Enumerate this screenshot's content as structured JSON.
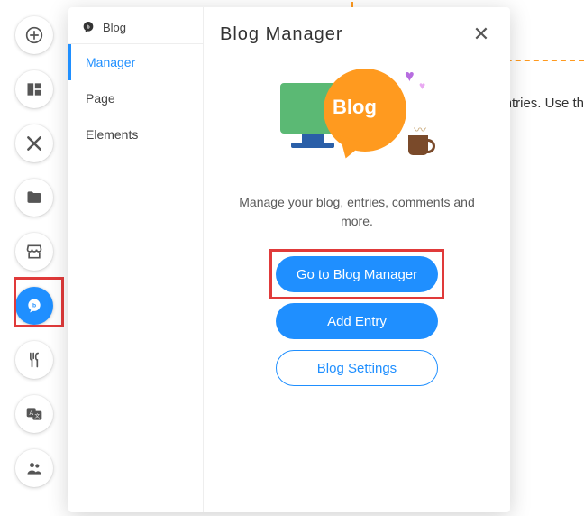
{
  "panel": {
    "blog_label": "Blog",
    "nav": {
      "manager": "Manager",
      "page": "Page",
      "elements": "Elements"
    },
    "title": "Blog Manager",
    "description": "Manage your blog, entries, comments and more.",
    "illustration_label": "Blog",
    "buttons": {
      "go_to_manager": "Go to Blog Manager",
      "add_entry": "Add Entry",
      "blog_settings": "Blog Settings"
    }
  },
  "background": {
    "peek_text": "ntries. Use th"
  }
}
